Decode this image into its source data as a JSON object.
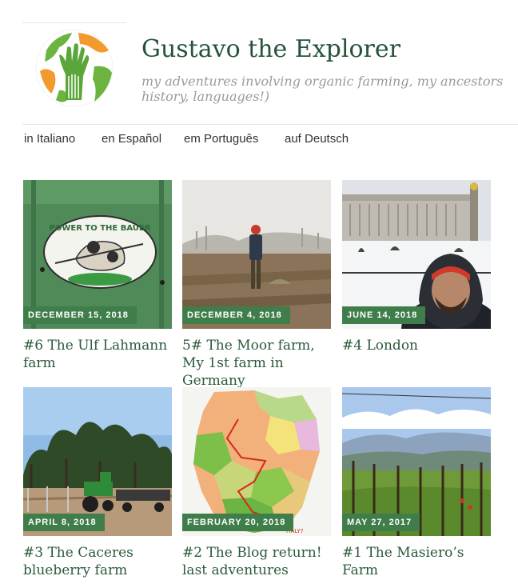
{
  "site": {
    "title": "Gustavo the Explorer",
    "tagline": "my adventures involving organic farming, my ancestors history, languages!)",
    "logo_icon": "globe-hand-logo"
  },
  "nav": {
    "languages": [
      "in Italiano",
      "en Español",
      "em Português",
      "auf Deutsch"
    ]
  },
  "posts": [
    {
      "date": "DECEMBER 15, 2018",
      "title": "#6 The Ulf Lahmann farm",
      "image": "power-to-the-bauer-sign",
      "sign_text": "POWER TO THE BAUER"
    },
    {
      "date": "DECEMBER 4, 2018",
      "title": "5# The Moor farm, My 1st farm in Germany",
      "image": "man-in-misty-field"
    },
    {
      "date": "JUNE 14, 2018",
      "title": "#4 London",
      "image": "selfie-buckingham-palace-snow"
    },
    {
      "date": "APRIL 8, 2018",
      "title": "#3 The Caceres blueberry farm",
      "image": "tractor-at-blueberry-farm"
    },
    {
      "date": "FEBRUARY 20, 2018",
      "title": "#2 The Blog return! last adventures",
      "image": "germany-route-map"
    },
    {
      "date": "MAY 27, 2017",
      "title": "#1 The Masiero’s Farm",
      "image": "vineyard-hills"
    }
  ],
  "colors": {
    "title": "#24533a",
    "badge": "#3f7d4a",
    "tagline": "#9a9a9a"
  }
}
